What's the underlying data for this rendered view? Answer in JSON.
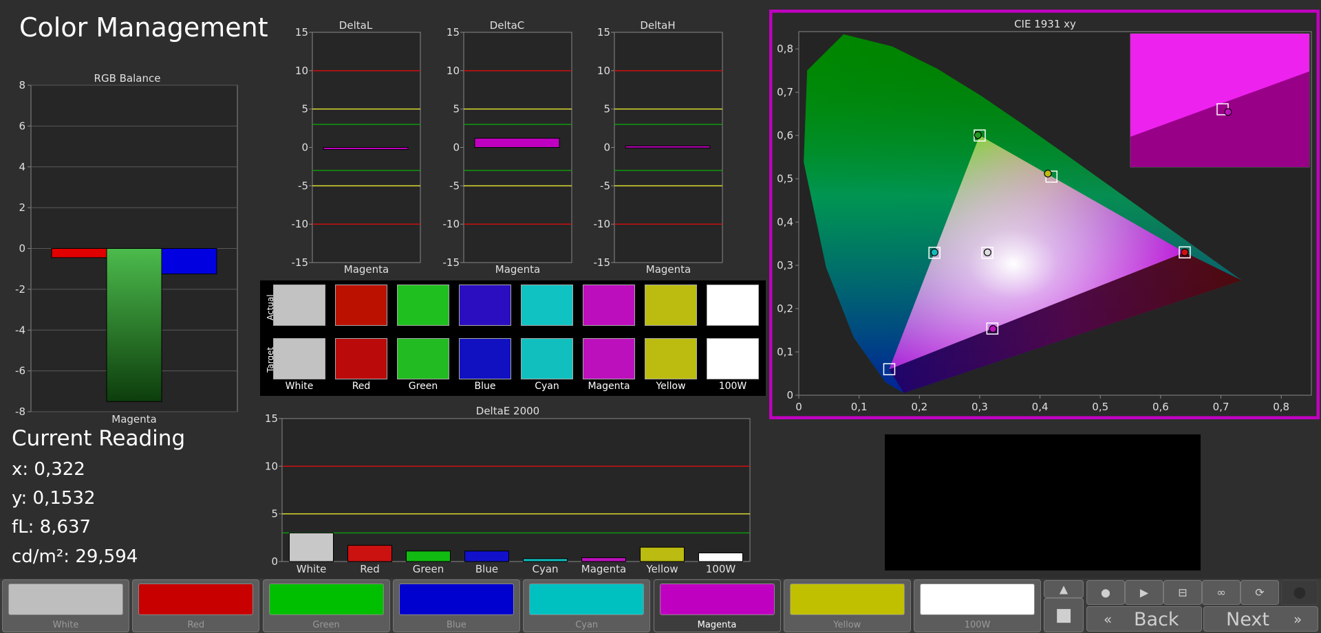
{
  "app": {
    "title": "Color Management"
  },
  "current_reading": {
    "heading": "Current Reading",
    "x": "x: 0,322",
    "y": "y: 0,1532",
    "fl": "fL: 8,637",
    "cdm2": "cd/m²: 29,594"
  },
  "chart_data": [
    {
      "type": "bar",
      "title": "RGB Balance",
      "categories": [
        "Magenta"
      ],
      "series": [
        {
          "name": "R",
          "values": [
            -0.45
          ],
          "color": "#e00000"
        },
        {
          "name": "G",
          "values": [
            -7.5
          ],
          "color": "#1a8a1a"
        },
        {
          "name": "B",
          "values": [
            -1.25
          ],
          "color": "#0000e0"
        }
      ],
      "ylim": [
        -8,
        8
      ],
      "yticks": [
        "8",
        "6",
        "4",
        "2",
        "0",
        "-2",
        "-4",
        "-6",
        "-8"
      ],
      "grid": true
    },
    {
      "type": "bar",
      "title": "DeltaL",
      "categories": [
        "Magenta"
      ],
      "values": [
        -0.2
      ],
      "ylim": [
        -15,
        15
      ],
      "yticks": [
        "15",
        "10",
        "5",
        "0",
        "-5",
        "-10",
        "-15"
      ]
    },
    {
      "type": "bar",
      "title": "DeltaC",
      "categories": [
        "Magenta"
      ],
      "values": [
        1.2
      ],
      "ylim": [
        -15,
        15
      ],
      "yticks": [
        "15",
        "10",
        "5",
        "0",
        "-5",
        "-10",
        "-15"
      ]
    },
    {
      "type": "bar",
      "title": "DeltaH",
      "categories": [
        "Magenta"
      ],
      "values": [
        0.2
      ],
      "ylim": [
        -15,
        15
      ],
      "yticks": [
        "15",
        "10",
        "5",
        "0",
        "-5",
        "-10",
        "-15"
      ]
    },
    {
      "type": "bar",
      "title": "DeltaE 2000",
      "categories": [
        "White",
        "Red",
        "Green",
        "Blue",
        "Cyan",
        "Magenta",
        "Yellow",
        "100W"
      ],
      "values": [
        3.0,
        1.7,
        1.1,
        1.1,
        0.3,
        0.4,
        1.5,
        0.9
      ],
      "colors": [
        "#c8c8c8",
        "#cc1111",
        "#11bb11",
        "#1111cc",
        "#11bbbb",
        "#bb11bb",
        "#bbbb11",
        "#ffffff"
      ],
      "ylim": [
        0,
        15
      ],
      "yticks": [
        "15",
        "10",
        "5",
        "0"
      ]
    },
    {
      "type": "scatter",
      "title": "CIE 1931 xy",
      "xlim": [
        0,
        0.85
      ],
      "ylim": [
        0,
        0.84
      ],
      "xticks": [
        "0",
        "0,1",
        "0,2",
        "0,3",
        "0,4",
        "0,5",
        "0,6",
        "0,7",
        "0,8"
      ],
      "yticks": [
        "0",
        "0,1",
        "0,2",
        "0,3",
        "0,4",
        "0,5",
        "0,6",
        "0,7",
        "0,8"
      ],
      "targets": [
        {
          "name": "Red",
          "x": 0.64,
          "y": 0.33
        },
        {
          "name": "Green",
          "x": 0.3,
          "y": 0.6
        },
        {
          "name": "Blue",
          "x": 0.15,
          "y": 0.06
        },
        {
          "name": "Cyan",
          "x": 0.225,
          "y": 0.329
        },
        {
          "name": "Magenta",
          "x": 0.321,
          "y": 0.154
        },
        {
          "name": "Yellow",
          "x": 0.419,
          "y": 0.505
        },
        {
          "name": "White",
          "x": 0.3127,
          "y": 0.329
        }
      ],
      "actuals": [
        {
          "name": "Green",
          "x": 0.297,
          "y": 0.601
        },
        {
          "name": "Yellow",
          "x": 0.413,
          "y": 0.512
        },
        {
          "name": "Cyan",
          "x": 0.225,
          "y": 0.33
        },
        {
          "name": "White",
          "x": 0.313,
          "y": 0.33
        },
        {
          "name": "Red",
          "x": 0.64,
          "y": 0.33
        },
        {
          "name": "Magenta",
          "x": 0.322,
          "y": 0.1532
        }
      ]
    }
  ],
  "swatches": {
    "actual_label": "Actual",
    "target_label": "Target",
    "items": [
      {
        "label": "White",
        "actual": "#c2c2c2",
        "target": "#c2c2c2"
      },
      {
        "label": "Red",
        "actual": "#bb1100",
        "target": "#bb0a0a"
      },
      {
        "label": "Green",
        "actual": "#1fbf1f",
        "target": "#22bb22"
      },
      {
        "label": "Blue",
        "actual": "#2a0ec0",
        "target": "#1111c2"
      },
      {
        "label": "Cyan",
        "actual": "#10c2c2",
        "target": "#12bfbf"
      },
      {
        "label": "Magenta",
        "actual": "#bc0ebc",
        "target": "#bc10bc"
      },
      {
        "label": "Yellow",
        "actual": "#bcbc10",
        "target": "#bcbc10"
      },
      {
        "label": "100W",
        "actual": "#ffffff",
        "target": "#ffffff"
      }
    ]
  },
  "patches": [
    {
      "label": "White",
      "color": "#bebebe"
    },
    {
      "label": "Red",
      "color": "#c80000"
    },
    {
      "label": "Green",
      "color": "#00bf00"
    },
    {
      "label": "Blue",
      "color": "#0000cf"
    },
    {
      "label": "Cyan",
      "color": "#00c0c0"
    },
    {
      "label": "Magenta",
      "color": "#c000c0"
    },
    {
      "label": "Yellow",
      "color": "#c0c000"
    },
    {
      "label": "100W",
      "color": "#ffffff"
    }
  ],
  "selected_patch": "Magenta",
  "controls": {
    "back_label": "Back",
    "next_label": "Next",
    "icons": [
      "up-arrow-icon",
      "stop-icon",
      "play-icon",
      "fit-icon",
      "loop-icon",
      "refresh-icon",
      "record-icon",
      "stop-square-icon"
    ]
  },
  "colors": {
    "accent": "#c000c0",
    "background": "#2e2e2e",
    "chart_bg": "#262626"
  }
}
